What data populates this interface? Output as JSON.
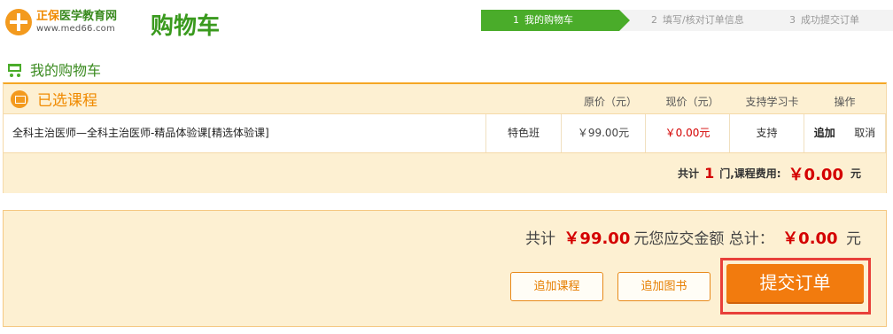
{
  "header": {
    "logo": {
      "name_prefix": "正保",
      "name_suffix": "医学教育网",
      "url": "www.med66.com"
    },
    "title": "购物车",
    "steps": [
      {
        "num": "1",
        "label": "我的购物车",
        "active": true
      },
      {
        "num": "2",
        "label": "填写/核对订单信息",
        "active": false
      },
      {
        "num": "3",
        "label": "成功提交订单",
        "active": false
      }
    ]
  },
  "cart": {
    "heading": "我的购物车",
    "icon": "cart-icon"
  },
  "courses": {
    "title": "已选课程",
    "icon": "monitor-icon",
    "columns": {
      "original_price": "原价（元）",
      "current_price": "现价（元）",
      "study_card": "支持学习卡",
      "operation": "操作"
    },
    "rows": [
      {
        "name": "全科主治医师—全科主治医师-精品体验课[精选体验课]",
        "type": "特色班",
        "original_price": "￥99.00元",
        "current_price": "￥0.00元",
        "study_card": "支持",
        "op_add": "追加",
        "op_cancel": "取消"
      }
    ],
    "total": {
      "prefix": "共计",
      "count": "1",
      "middle": "门,课程费用:",
      "fee": "￥0.00",
      "unit": "元"
    }
  },
  "summary": {
    "total_label": "共计",
    "total_amount": "￥99.00",
    "payable_label": "元您应交金额 总计：",
    "payable_amount": "￥0.00",
    "unit": "元",
    "add_course_label": "追加课程",
    "add_book_label": "追加图书",
    "submit_label": "提交订单"
  },
  "colors": {
    "brand_green": "#4aac2a",
    "accent_orange": "#f27b0e",
    "price_red": "#d40000",
    "panel_bg": "#fdf0d2"
  }
}
